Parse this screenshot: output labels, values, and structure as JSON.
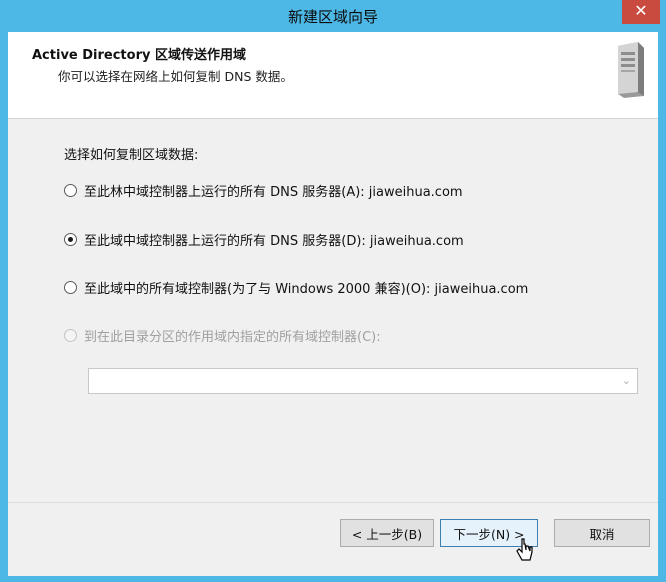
{
  "window": {
    "title": "新建区域向导",
    "close_symbol": "✕"
  },
  "header": {
    "title": "Active Directory 区域传送作用域",
    "subtitle": "你可以选择在网络上如何复制 DNS 数据。",
    "icon": "server-icon"
  },
  "body": {
    "prompt": "选择如何复制区域数据:",
    "options": [
      {
        "label": "至此林中域控制器上运行的所有 DNS 服务器(A): jiaweihua.com",
        "checked": false,
        "enabled": true
      },
      {
        "label": "至此域中域控制器上运行的所有 DNS 服务器(D): jiaweihua.com",
        "checked": true,
        "enabled": true
      },
      {
        "label": "至此域中的所有域控制器(为了与 Windows 2000 兼容)(O): jiaweihua.com",
        "checked": false,
        "enabled": true
      },
      {
        "label": "到在此目录分区的作用域内指定的所有域控制器(C):",
        "checked": false,
        "enabled": false
      }
    ],
    "partition_select": {
      "value": "",
      "enabled": false,
      "arrow": "⌄"
    }
  },
  "footer": {
    "back_label": "< 上一步(B)",
    "next_label": "下一步(N) >",
    "cancel_label": "取消"
  }
}
